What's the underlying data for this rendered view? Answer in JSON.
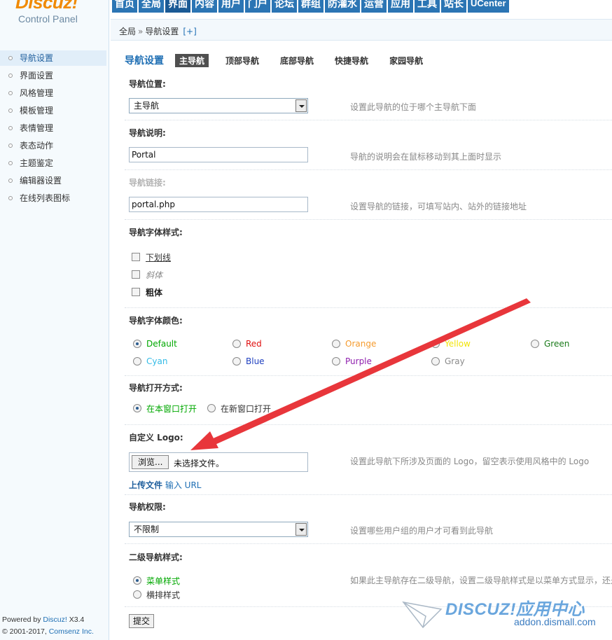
{
  "brand": {
    "logo": "Discuz!",
    "subtitle": "Control Panel"
  },
  "topnav": [
    "首页",
    "全局",
    "界面",
    "内容",
    "用户",
    "门户",
    "论坛",
    "群组",
    "防灌水",
    "运营",
    "应用",
    "工具",
    "站长",
    "UCenter"
  ],
  "breadcrumb": {
    "root": "全局",
    "sep": "»",
    "current": "导航设置",
    "add": "[+]"
  },
  "sidebar": {
    "items": [
      "导航设置",
      "界面设置",
      "风格管理",
      "模板管理",
      "表情管理",
      "表态动作",
      "主题鉴定",
      "编辑器设置",
      "在线列表图标"
    ],
    "footer_powered": "Powered by",
    "footer_brand": "Discuz!",
    "footer_version": " X3.4",
    "footer_copy": "© 2001-2017, ",
    "footer_company": "Comsenz Inc."
  },
  "page": {
    "title": "导航设置",
    "tabs": [
      "主导航",
      "顶部导航",
      "底部导航",
      "快捷导航",
      "家园导航"
    ]
  },
  "form": {
    "position": {
      "label": "导航位置:",
      "value": "主导航",
      "tip": "设置此导航的位于哪个主导航下面"
    },
    "desc": {
      "label": "导航说明:",
      "value": "Portal",
      "tip": "导航的说明会在鼠标移动到其上面时显示"
    },
    "link": {
      "label": "导航链接:",
      "value": "portal.php",
      "tip": "设置导航的链接，可填写站内、站外的链接地址"
    },
    "font_style": {
      "label": "导航字体样式:",
      "options": [
        "下划线",
        "斜体",
        "粗体"
      ]
    },
    "font_color": {
      "label": "导航字体颜色:",
      "options": [
        {
          "label": "Default",
          "color": "#00a800"
        },
        {
          "label": "Red",
          "color": "#e01010"
        },
        {
          "label": "Orange",
          "color": "#f59b2e"
        },
        {
          "label": "Yellow",
          "color": "#f2e40a"
        },
        {
          "label": "Green",
          "color": "#1a7a1a"
        },
        {
          "label": "Cyan",
          "color": "#33bbe6"
        },
        {
          "label": "Blue",
          "color": "#1e3fbf"
        },
        {
          "label": "Purple",
          "color": "#8f1fad"
        },
        {
          "label": "Gray",
          "color": "#8a8a8a"
        }
      ]
    },
    "open_mode": {
      "label": "导航打开方式:",
      "options": [
        "在本窗口打开",
        "在新窗口打开"
      ]
    },
    "logo": {
      "label": "自定义 Logo:",
      "browse": "浏览...",
      "no_file": "未选择文件。",
      "tip": "设置此导航下所涉及页面的 Logo，留空表示使用风格中的 Logo",
      "upload": "上传文件",
      "input_url": "输入 URL"
    },
    "permission": {
      "label": "导航权限:",
      "value": "不限制",
      "tip": "设置哪些用户组的用户才可看到此导航"
    },
    "sub_style": {
      "label": "二级导航样式:",
      "options": [
        "菜单样式",
        "横排样式"
      ],
      "tip": "如果此主导航存在二级导航，设置二级导航样式是以菜单方式显示，还是"
    },
    "submit": "提交"
  },
  "watermark": {
    "main": "DISCUZ!应用中心",
    "sub": "addon.dismall.com"
  },
  "colors": {
    "accent": "#1f6fb4",
    "nav_bg": "#2b75b4",
    "arrow": "#e8363b",
    "sidebar_bg": "#f5fafd"
  }
}
